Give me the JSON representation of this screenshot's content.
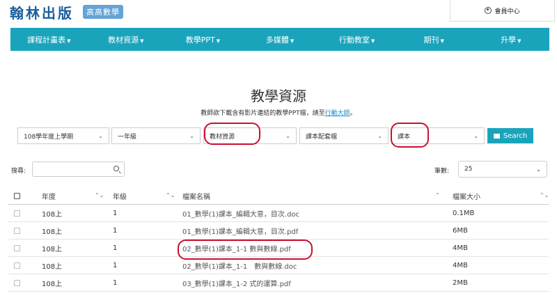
{
  "header": {
    "logo": "翰林出版",
    "logo_badge": "高高數學",
    "member_label": "會員中心"
  },
  "nav": [
    {
      "label": "課程計畫表"
    },
    {
      "label": "教材資源"
    },
    {
      "label": "教學PPT"
    },
    {
      "label": "多媒體"
    },
    {
      "label": "行動教室"
    },
    {
      "label": "期刊"
    },
    {
      "label": "升學"
    }
  ],
  "page": {
    "title": "教學資源",
    "subtitle_before": "教師欲下載含有影片連結的教學PPT檔，請至",
    "subtitle_link": "行動大師",
    "subtitle_after": "。"
  },
  "filters": {
    "term": "108學年度上學期",
    "grade": "一年級",
    "resource": "教材資源",
    "category": "課本配套檔",
    "book": "課本",
    "search_label": "Search"
  },
  "search": {
    "label": "搜尋:",
    "value": ""
  },
  "pagesize": {
    "label": "筆數:",
    "value": "25"
  },
  "table": {
    "columns": {
      "year": "年度",
      "grade": "年級",
      "filename": "檔案名稱",
      "size": "檔案大小"
    },
    "rows": [
      {
        "year": "108上",
        "grade": "1",
        "filename": "01_數學(1)課本_編輯大意，目次.doc",
        "size": "0.1MB"
      },
      {
        "year": "108上",
        "grade": "1",
        "filename": "01_數學(1)課本_編輯大意，目次.pdf",
        "size": "6MB"
      },
      {
        "year": "108上",
        "grade": "1",
        "filename": "02_數學(1)課本_1-1 數與數線.pdf",
        "size": "4MB"
      },
      {
        "year": "108上",
        "grade": "1",
        "filename": "02_數學(1)課本_1-1　數與數線.doc",
        "size": "4MB"
      },
      {
        "year": "108上",
        "grade": "1",
        "filename": "03_數學(1)課本_1-2 式的運算.pdf",
        "size": "2MB"
      }
    ]
  },
  "colors": {
    "accent": "#1aa4bc",
    "logo": "#1a5f9e",
    "annotation": "#c8102e"
  }
}
